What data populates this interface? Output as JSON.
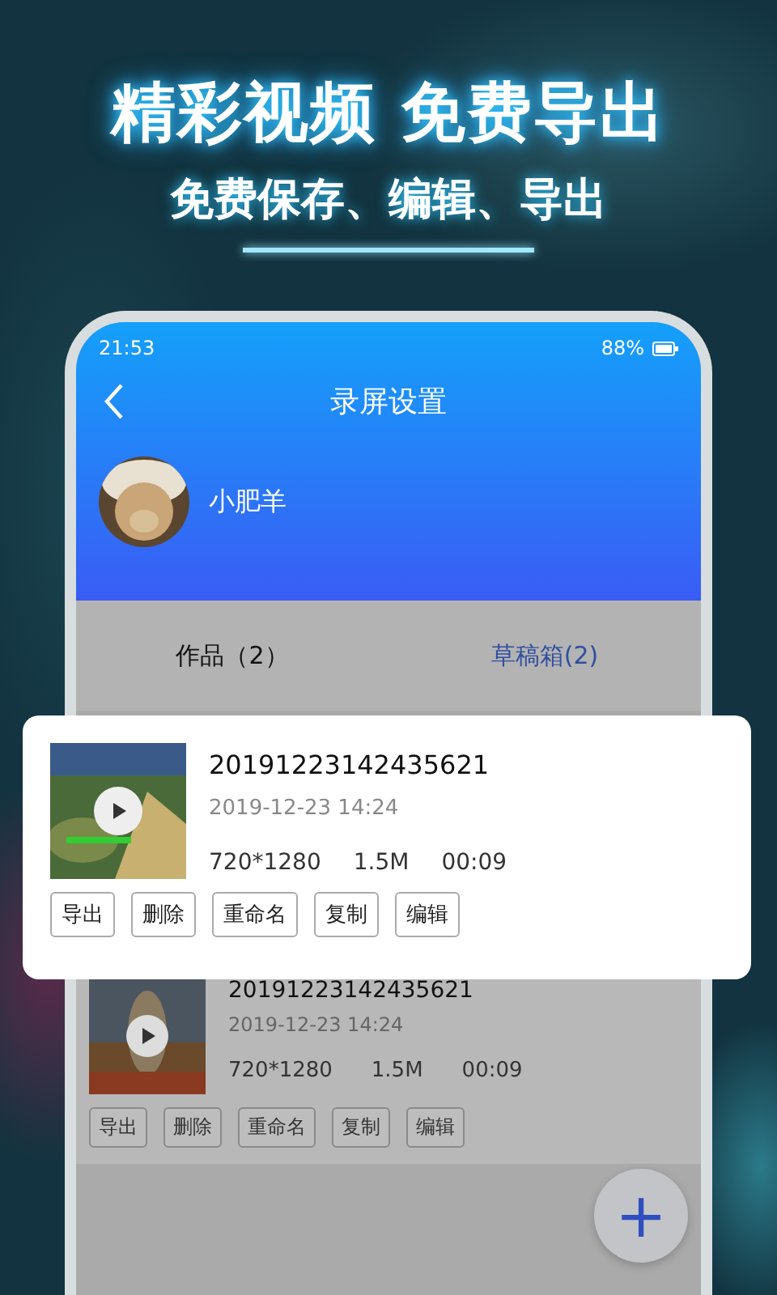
{
  "headline": "精彩视频 免费导出",
  "subheadline": "免费保存、编辑、导出",
  "status_bar": {
    "time": "21:53",
    "battery": "88%"
  },
  "header": {
    "title": "录屏设置"
  },
  "profile": {
    "name": "小肥羊"
  },
  "tabs": [
    {
      "label": "作品（2）",
      "selected": false
    },
    {
      "label": "草稿箱(2)",
      "selected": true
    }
  ],
  "featured_video": {
    "name": "20191223142435621",
    "date": "2019-12-23 14:24",
    "resolution": "720*1280",
    "size": "1.5M",
    "duration": "00:09",
    "actions": [
      "导出",
      "删除",
      "重命名",
      "复制",
      "编辑"
    ]
  },
  "videos": [
    {
      "name": "20191223142435621",
      "date": "2019-12-23 14:24",
      "resolution": "720*1280",
      "size": "1.5M",
      "duration": "00:09",
      "actions": [
        "导出",
        "删除",
        "重命名",
        "复制",
        "编辑"
      ]
    }
  ],
  "fab": {
    "label": "+"
  }
}
